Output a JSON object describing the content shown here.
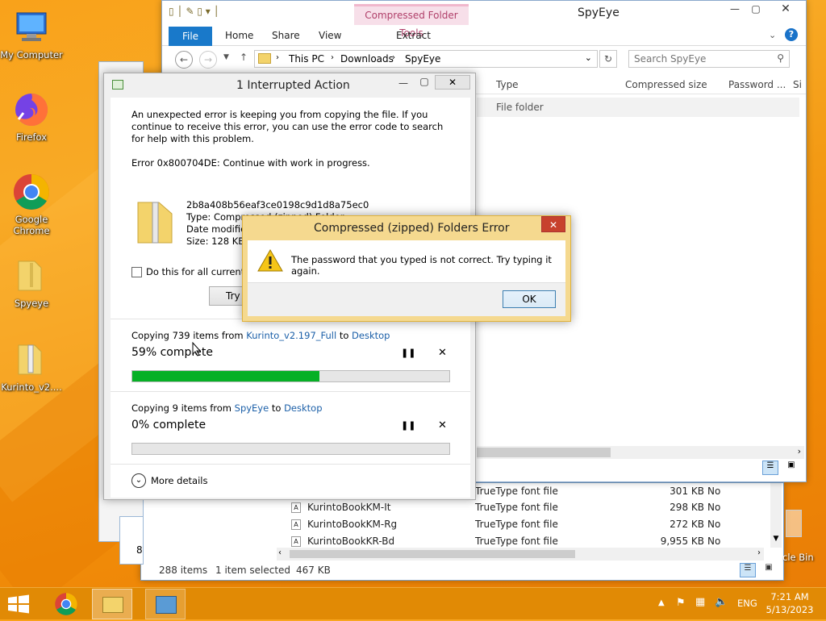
{
  "desktop": {
    "icons": [
      {
        "label": "My Computer"
      },
      {
        "label": "Firefox"
      },
      {
        "label": "Google Chrome"
      },
      {
        "label": "Spyeye"
      },
      {
        "label": "Kurinto_v2...."
      }
    ],
    "recycle_partial": "cle Bin"
  },
  "explorer": {
    "contextual_tab": "Compressed Folder Tools",
    "title": "SpyEye",
    "tabs": [
      "File",
      "Home",
      "Share",
      "View",
      "Extract"
    ],
    "breadcrumb": [
      "This PC",
      "Downloads",
      "SpyEye"
    ],
    "search_placeholder": "Search SpyEye",
    "columns": [
      "Type",
      "Compressed size",
      "Password ...",
      "Si"
    ],
    "first_row_type": "File folder"
  },
  "back_window": {
    "rows": [
      {
        "name": "",
        "type": "TrueType font file",
        "size": "301 KB",
        "flag": "No"
      },
      {
        "name": "KurintoBookKM-It",
        "type": "TrueType font file",
        "size": "298 KB",
        "flag": "No"
      },
      {
        "name": "KurintoBookKM-Rg",
        "type": "TrueType font file",
        "size": "272 KB",
        "flag": "No"
      },
      {
        "name": "KurintoBookKR-Bd",
        "type": "TrueType font file",
        "size": "9,955 KB",
        "flag": "No"
      }
    ],
    "status_items": "288 items",
    "status_selected": "1 item selected",
    "status_size": "467 KB",
    "partial_8": "8"
  },
  "interrupted": {
    "title": "1 Interrupted Action",
    "message": "An unexpected error is keeping you from copying the file. If you continue to receive this error, you can use the error code to search for help with this problem.",
    "error_code": "Error 0x800704DE: Continue with work in progress.",
    "file_name": "2b8a408b56eaf3ce0198c9d1d8a75ec0",
    "file_type": "Type: Compressed (zipped) Folder",
    "file_date": "Date modifie",
    "file_size": "Size: 128 KB",
    "checkbox_label": "Do this for all current it",
    "try_button": "Try",
    "copy1_prefix": "Copying 739 items from ",
    "copy1_source": "Kurinto_v2.197_Full",
    "copy1_to": " to ",
    "copy1_dest": "Desktop",
    "copy1_status": "59% complete",
    "copy1_progress": 0.59,
    "copy2_prefix": "Copying 9 items from ",
    "copy2_source": "SpyEye",
    "copy2_to": " to ",
    "copy2_dest": "Desktop",
    "copy2_status": "0% complete",
    "copy2_progress": 0.0,
    "more_details": "More details"
  },
  "error_dialog": {
    "title": "Compressed (zipped) Folders Error",
    "message": "The password that you typed is not correct. Try typing it again.",
    "ok": "OK"
  },
  "taskbar": {
    "lang": "ENG",
    "time": "7:21 AM",
    "date": "5/13/2023"
  }
}
